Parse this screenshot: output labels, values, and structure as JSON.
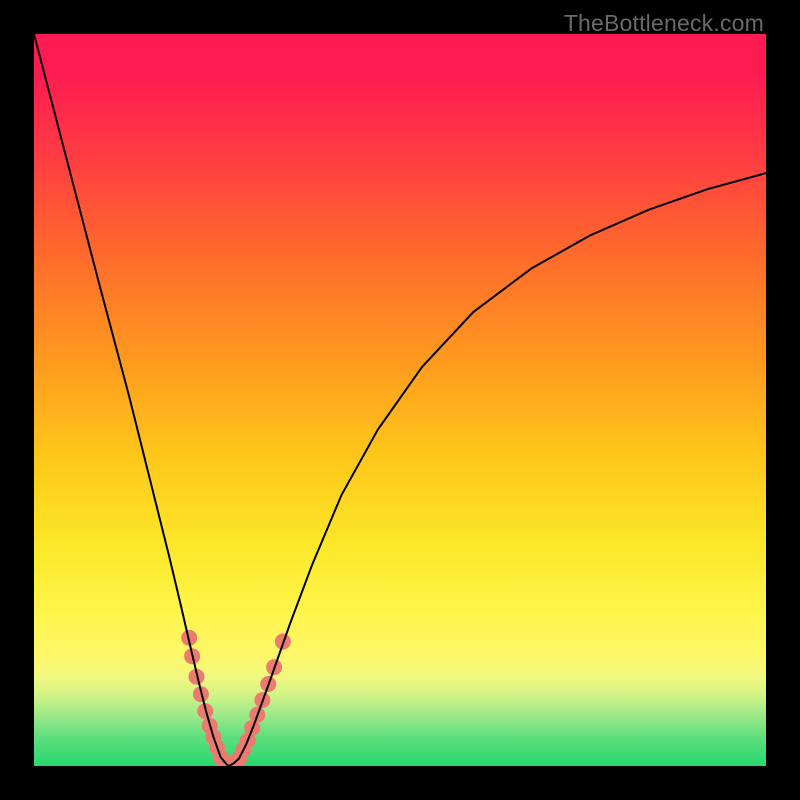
{
  "watermark": "TheBottleneck.com",
  "chart_data": {
    "type": "line",
    "title": "",
    "xlabel": "",
    "ylabel": "",
    "xlim": [
      0,
      1
    ],
    "ylim": [
      0,
      1
    ],
    "series": [
      {
        "name": "curve",
        "x": [
          0.0,
          0.03,
          0.06,
          0.09,
          0.11,
          0.13,
          0.15,
          0.17,
          0.185,
          0.2,
          0.212,
          0.225,
          0.235,
          0.245,
          0.255,
          0.265,
          0.272,
          0.28,
          0.29,
          0.3,
          0.32,
          0.35,
          0.38,
          0.42,
          0.47,
          0.53,
          0.6,
          0.68,
          0.76,
          0.84,
          0.92,
          1.0
        ],
        "y": [
          1.0,
          0.885,
          0.77,
          0.655,
          0.58,
          0.505,
          0.425,
          0.345,
          0.285,
          0.222,
          0.17,
          0.115,
          0.075,
          0.04,
          0.012,
          0.0,
          0.003,
          0.01,
          0.03,
          0.055,
          0.11,
          0.195,
          0.275,
          0.37,
          0.46,
          0.545,
          0.62,
          0.68,
          0.725,
          0.76,
          0.788,
          0.81
        ]
      }
    ],
    "markers": {
      "name": "dots",
      "points": [
        {
          "x": 0.212,
          "y": 0.175
        },
        {
          "x": 0.216,
          "y": 0.15
        },
        {
          "x": 0.222,
          "y": 0.122
        },
        {
          "x": 0.228,
          "y": 0.098
        },
        {
          "x": 0.234,
          "y": 0.075
        },
        {
          "x": 0.24,
          "y": 0.055
        },
        {
          "x": 0.245,
          "y": 0.04
        },
        {
          "x": 0.25,
          "y": 0.025
        },
        {
          "x": 0.255,
          "y": 0.012
        },
        {
          "x": 0.26,
          "y": 0.004
        },
        {
          "x": 0.265,
          "y": 0.0
        },
        {
          "x": 0.27,
          "y": 0.001
        },
        {
          "x": 0.275,
          "y": 0.005
        },
        {
          "x": 0.28,
          "y": 0.01
        },
        {
          "x": 0.286,
          "y": 0.022
        },
        {
          "x": 0.292,
          "y": 0.035
        },
        {
          "x": 0.298,
          "y": 0.052
        },
        {
          "x": 0.305,
          "y": 0.07
        },
        {
          "x": 0.312,
          "y": 0.09
        },
        {
          "x": 0.32,
          "y": 0.112
        },
        {
          "x": 0.328,
          "y": 0.135
        },
        {
          "x": 0.34,
          "y": 0.17
        }
      ],
      "color": "#ed7a6f",
      "radius": 8
    },
    "curve_color": "#000000",
    "curve_width": 2
  }
}
